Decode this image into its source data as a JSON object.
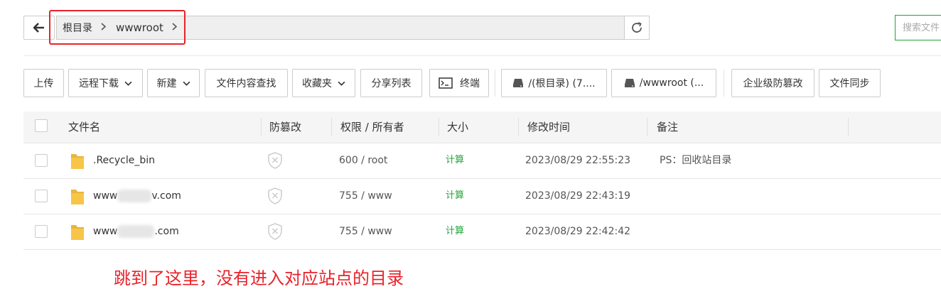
{
  "breadcrumbs": [
    {
      "label": "根目录"
    },
    {
      "label": "wwwroot"
    }
  ],
  "search": {
    "placeholder": "搜索文件"
  },
  "toolbar": {
    "upload": "上传",
    "remote_download": "远程下载",
    "new": "新建",
    "content_search": "文件内容查找",
    "favorites": "收藏夹",
    "share_list": "分享列表",
    "terminal": "终端",
    "disk_root": "/(根目录) (7....",
    "disk_wwwroot": "/wwwroot (...",
    "enterprise_tamper": "企业级防篡改",
    "file_sync": "文件同步"
  },
  "table": {
    "columns": {
      "name": "文件名",
      "tamper": "防篡改",
      "perm": "权限 / 所有者",
      "size": "大小",
      "mtime": "修改时间",
      "remark": "备注"
    },
    "rows": [
      {
        "name_pre": ".Recycle_bin",
        "name_post": "",
        "perm": "600 / root",
        "size": "计算",
        "mtime": "2023/08/29 22:55:23",
        "remark": "PS：回收站目录"
      },
      {
        "name_pre": "www",
        "name_post": "v.com",
        "perm": "755 / www",
        "size": "计算",
        "mtime": "2023/08/29 22:43:19",
        "remark": ""
      },
      {
        "name_pre": "www",
        "name_post": ".com",
        "perm": "755 / www",
        "size": "计算",
        "mtime": "2023/08/29 22:42:42",
        "remark": ""
      }
    ]
  },
  "annotation": "跳到了这里，没有进入对应站点的目录",
  "colors": {
    "accent": "#20a53a",
    "annotation": "#e8232a",
    "folder": "#f7c548"
  }
}
